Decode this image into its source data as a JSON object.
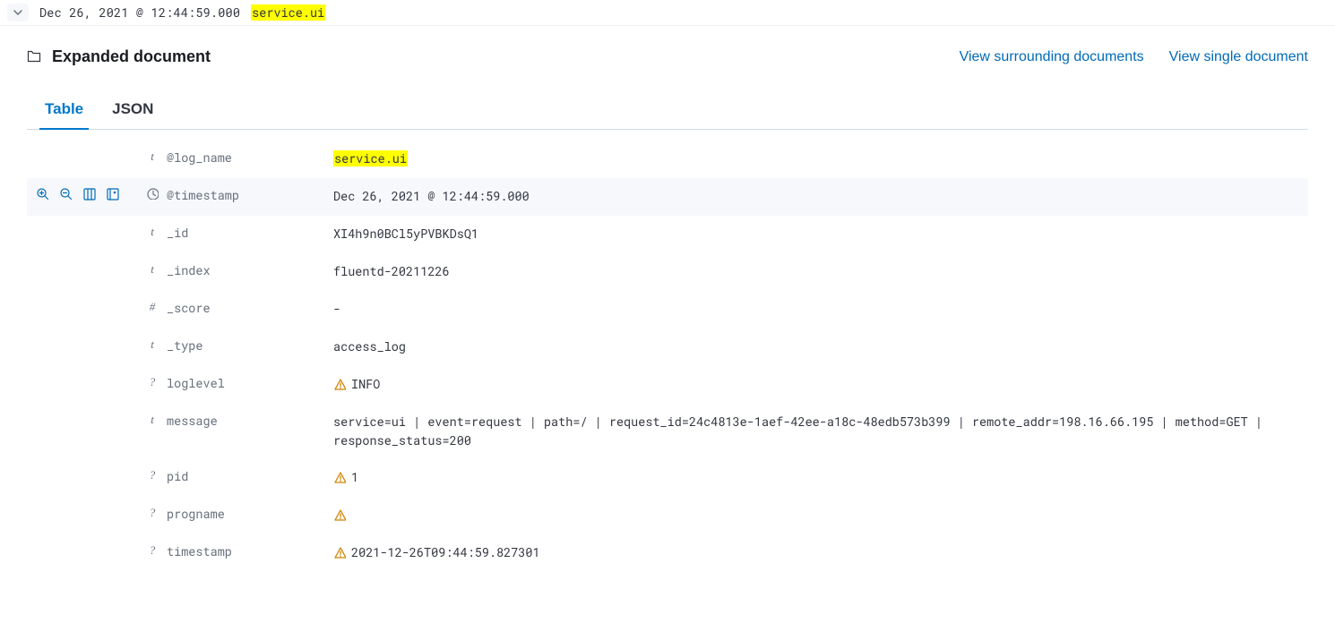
{
  "top": {
    "timestamp": "Dec 26, 2021 @ 12:44:59.000",
    "highlight": "service.ui"
  },
  "header": {
    "title": "Expanded document",
    "link_surrounding": "View surrounding documents",
    "link_single": "View single document"
  },
  "tabs": {
    "table": "Table",
    "json": "JSON"
  },
  "fields": [
    {
      "type": "t",
      "name": "@log_name",
      "value": "service.ui",
      "hl": true,
      "warn": false,
      "hovered": false
    },
    {
      "type": "clock",
      "name": "@timestamp",
      "value": "Dec 26, 2021 @ 12:44:59.000",
      "hl": false,
      "warn": false,
      "hovered": true
    },
    {
      "type": "t",
      "name": "_id",
      "value": "XI4h9n0BCl5yPVBKDsQ1",
      "hl": false,
      "warn": false,
      "hovered": false
    },
    {
      "type": "t",
      "name": "_index",
      "value": "fluentd-20211226",
      "hl": false,
      "warn": false,
      "hovered": false
    },
    {
      "type": "#",
      "name": "_score",
      "value": " - ",
      "hl": false,
      "warn": false,
      "hovered": false
    },
    {
      "type": "t",
      "name": "_type",
      "value": "access_log",
      "hl": false,
      "warn": false,
      "hovered": false
    },
    {
      "type": "?",
      "name": "loglevel",
      "value": "INFO",
      "hl": false,
      "warn": true,
      "hovered": false
    },
    {
      "type": "t",
      "name": "message",
      "value": "service=ui | event=request | path=/ | request_id=24c4813e-1aef-42ee-a18c-48edb573b399 | remote_addr=198.16.66.195 | method=GET | response_status=200",
      "hl": false,
      "warn": false,
      "hovered": false
    },
    {
      "type": "?",
      "name": "pid",
      "value": "1",
      "hl": false,
      "warn": true,
      "hovered": false
    },
    {
      "type": "?",
      "name": "progname",
      "value": "",
      "hl": false,
      "warn": true,
      "hovered": false
    },
    {
      "type": "?",
      "name": "timestamp",
      "value": "2021-12-26T09:44:59.827301",
      "hl": false,
      "warn": true,
      "hovered": false
    }
  ]
}
